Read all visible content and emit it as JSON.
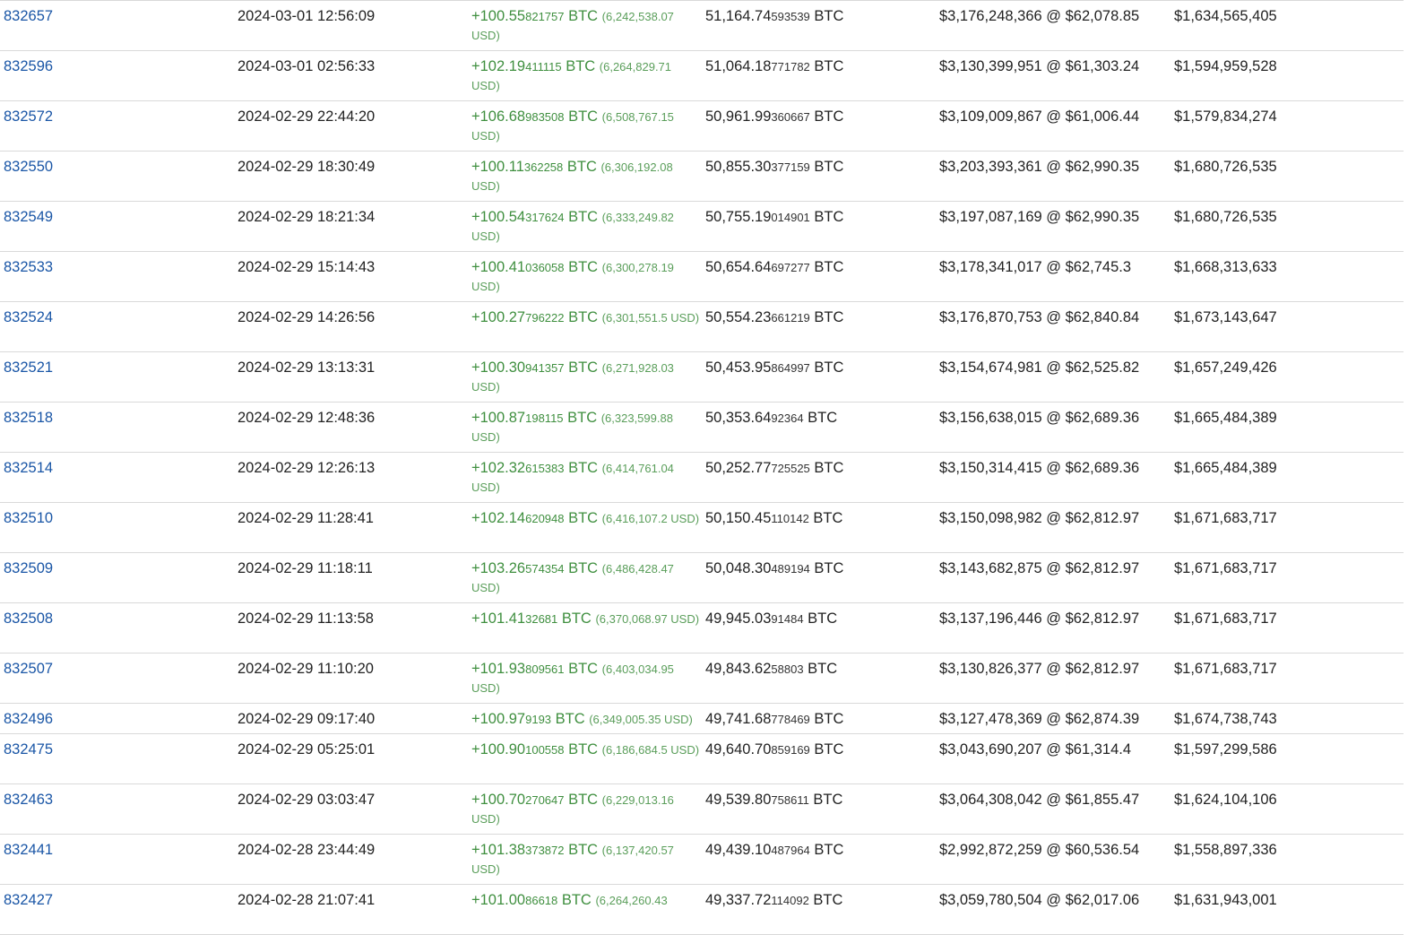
{
  "rows": [
    {
      "block": "832657",
      "time": "2024-03-01 12:56:09",
      "amt_main": "+100.55",
      "amt_dec": "821757",
      "amt_unit": " BTC ",
      "amt_usd": "(6,242,538.07 USD)",
      "bal_main": "51,164.74",
      "bal_dec": "593539",
      "bal_unit": " BTC",
      "value": "$3,176,248,366 @ $62,078.85",
      "mcap": "$1,634,565,405"
    },
    {
      "block": "832596",
      "time": "2024-03-01 02:56:33",
      "amt_main": "+102.19",
      "amt_dec": "411115",
      "amt_unit": " BTC ",
      "amt_usd": "(6,264,829.71 USD)",
      "bal_main": "51,064.18",
      "bal_dec": "771782",
      "bal_unit": " BTC",
      "value": "$3,130,399,951 @ $61,303.24",
      "mcap": "$1,594,959,528"
    },
    {
      "block": "832572",
      "time": "2024-02-29 22:44:20",
      "amt_main": "+106.68",
      "amt_dec": "983508",
      "amt_unit": " BTC ",
      "amt_usd": "(6,508,767.15 USD)",
      "bal_main": "50,961.99",
      "bal_dec": "360667",
      "bal_unit": " BTC",
      "value": "$3,109,009,867 @ $61,006.44",
      "mcap": "$1,579,834,274"
    },
    {
      "block": "832550",
      "time": "2024-02-29 18:30:49",
      "amt_main": "+100.11",
      "amt_dec": "362258",
      "amt_unit": " BTC ",
      "amt_usd": "(6,306,192.08 USD)",
      "bal_main": "50,855.30",
      "bal_dec": "377159",
      "bal_unit": " BTC",
      "value": "$3,203,393,361 @ $62,990.35",
      "mcap": "$1,680,726,535"
    },
    {
      "block": "832549",
      "time": "2024-02-29 18:21:34",
      "amt_main": "+100.54",
      "amt_dec": "317624",
      "amt_unit": " BTC ",
      "amt_usd": "(6,333,249.82 USD)",
      "bal_main": "50,755.19",
      "bal_dec": "014901",
      "bal_unit": " BTC",
      "value": "$3,197,087,169 @ $62,990.35",
      "mcap": "$1,680,726,535"
    },
    {
      "block": "832533",
      "time": "2024-02-29 15:14:43",
      "amt_main": "+100.41",
      "amt_dec": "036058",
      "amt_unit": " BTC ",
      "amt_usd": "(6,300,278.19 USD)",
      "bal_main": "50,654.64",
      "bal_dec": "697277",
      "bal_unit": " BTC",
      "value": "$3,178,341,017 @ $62,745.3",
      "mcap": "$1,668,313,633"
    },
    {
      "block": "832524",
      "time": "2024-02-29 14:26:56",
      "amt_main": "+100.27",
      "amt_dec": "796222",
      "amt_unit": " BTC ",
      "amt_usd": "(6,301,551.5 USD)",
      "bal_main": "50,554.23",
      "bal_dec": "661219",
      "bal_unit": " BTC",
      "value": "$3,176,870,753 @ $62,840.84",
      "mcap": "$1,673,143,647"
    },
    {
      "block": "832521",
      "time": "2024-02-29 13:13:31",
      "amt_main": "+100.30",
      "amt_dec": "941357",
      "amt_unit": " BTC ",
      "amt_usd": "(6,271,928.03 USD)",
      "bal_main": "50,453.95",
      "bal_dec": "864997",
      "bal_unit": " BTC",
      "value": "$3,154,674,981 @ $62,525.82",
      "mcap": "$1,657,249,426"
    },
    {
      "block": "832518",
      "time": "2024-02-29 12:48:36",
      "amt_main": "+100.87",
      "amt_dec": "198115",
      "amt_unit": " BTC ",
      "amt_usd": "(6,323,599.88 USD)",
      "bal_main": "50,353.64",
      "bal_dec": "92364",
      "bal_unit": " BTC",
      "value": "$3,156,638,015 @ $62,689.36",
      "mcap": "$1,665,484,389"
    },
    {
      "block": "832514",
      "time": "2024-02-29 12:26:13",
      "amt_main": "+102.32",
      "amt_dec": "615383",
      "amt_unit": " BTC ",
      "amt_usd": "(6,414,761.04 USD)",
      "bal_main": "50,252.77",
      "bal_dec": "725525",
      "bal_unit": " BTC",
      "value": "$3,150,314,415 @ $62,689.36",
      "mcap": "$1,665,484,389"
    },
    {
      "block": "832510",
      "time": "2024-02-29 11:28:41",
      "amt_main": "+102.14",
      "amt_dec": "620948",
      "amt_unit": " BTC ",
      "amt_usd": "(6,416,107.2 USD)",
      "bal_main": "50,150.45",
      "bal_dec": "110142",
      "bal_unit": " BTC",
      "value": "$3,150,098,982 @ $62,812.97",
      "mcap": "$1,671,683,717"
    },
    {
      "block": "832509",
      "time": "2024-02-29 11:18:11",
      "amt_main": "+103.26",
      "amt_dec": "574354",
      "amt_unit": " BTC ",
      "amt_usd": "(6,486,428.47 USD)",
      "bal_main": "50,048.30",
      "bal_dec": "489194",
      "bal_unit": " BTC",
      "value": "$3,143,682,875 @ $62,812.97",
      "mcap": "$1,671,683,717"
    },
    {
      "block": "832508",
      "time": "2024-02-29 11:13:58",
      "amt_main": "+101.41",
      "amt_dec": "32681",
      "amt_unit": " BTC ",
      "amt_usd": "(6,370,068.97 USD)",
      "bal_main": "49,945.03",
      "bal_dec": "91484",
      "bal_unit": " BTC",
      "value": "$3,137,196,446 @ $62,812.97",
      "mcap": "$1,671,683,717"
    },
    {
      "block": "832507",
      "time": "2024-02-29 11:10:20",
      "amt_main": "+101.93",
      "amt_dec": "809561",
      "amt_unit": " BTC ",
      "amt_usd": "(6,403,034.95 USD)",
      "bal_main": "49,843.62",
      "bal_dec": "58803",
      "bal_unit": " BTC",
      "value": "$3,130,826,377 @ $62,812.97",
      "mcap": "$1,671,683,717"
    },
    {
      "block": "832496",
      "time": "2024-02-29 09:17:40",
      "amt_main": "+100.97",
      "amt_dec": "9193",
      "amt_unit": " BTC ",
      "amt_usd": "(6,349,005.35 USD)",
      "bal_main": "49,741.68",
      "bal_dec": "778469",
      "bal_unit": " BTC",
      "value": "$3,127,478,369 @ $62,874.39",
      "mcap": "$1,674,738,743"
    },
    {
      "block": "832475",
      "time": "2024-02-29 05:25:01",
      "amt_main": "+100.90",
      "amt_dec": "100558",
      "amt_unit": " BTC ",
      "amt_usd": "(6,186,684.5 USD)",
      "bal_main": "49,640.70",
      "bal_dec": "859169",
      "bal_unit": " BTC",
      "value": "$3,043,690,207 @ $61,314.4",
      "mcap": "$1,597,299,586"
    },
    {
      "block": "832463",
      "time": "2024-02-29 03:03:47",
      "amt_main": "+100.70",
      "amt_dec": "270647",
      "amt_unit": " BTC ",
      "amt_usd": "(6,229,013.16 USD)",
      "bal_main": "49,539.80",
      "bal_dec": "758611",
      "bal_unit": " BTC",
      "value": "$3,064,308,042 @ $61,855.47",
      "mcap": "$1,624,104,106"
    },
    {
      "block": "832441",
      "time": "2024-02-28 23:44:49",
      "amt_main": "+101.38",
      "amt_dec": "373872",
      "amt_unit": " BTC ",
      "amt_usd": "(6,137,420.57 USD)",
      "bal_main": "49,439.10",
      "bal_dec": "487964",
      "bal_unit": " BTC",
      "value": "$2,992,872,259 @ $60,536.54",
      "mcap": "$1,558,897,336"
    },
    {
      "block": "832427",
      "time": "2024-02-28 21:07:41",
      "amt_main": "+101.00",
      "amt_dec": "86618",
      "amt_unit": " BTC ",
      "amt_usd": "(6,264,260.43",
      "bal_main": "49,337.72",
      "bal_dec": "114092",
      "bal_unit": " BTC",
      "value": "$3,059,780,504 @ $62,017.06",
      "mcap": "$1,631,943,001"
    }
  ]
}
